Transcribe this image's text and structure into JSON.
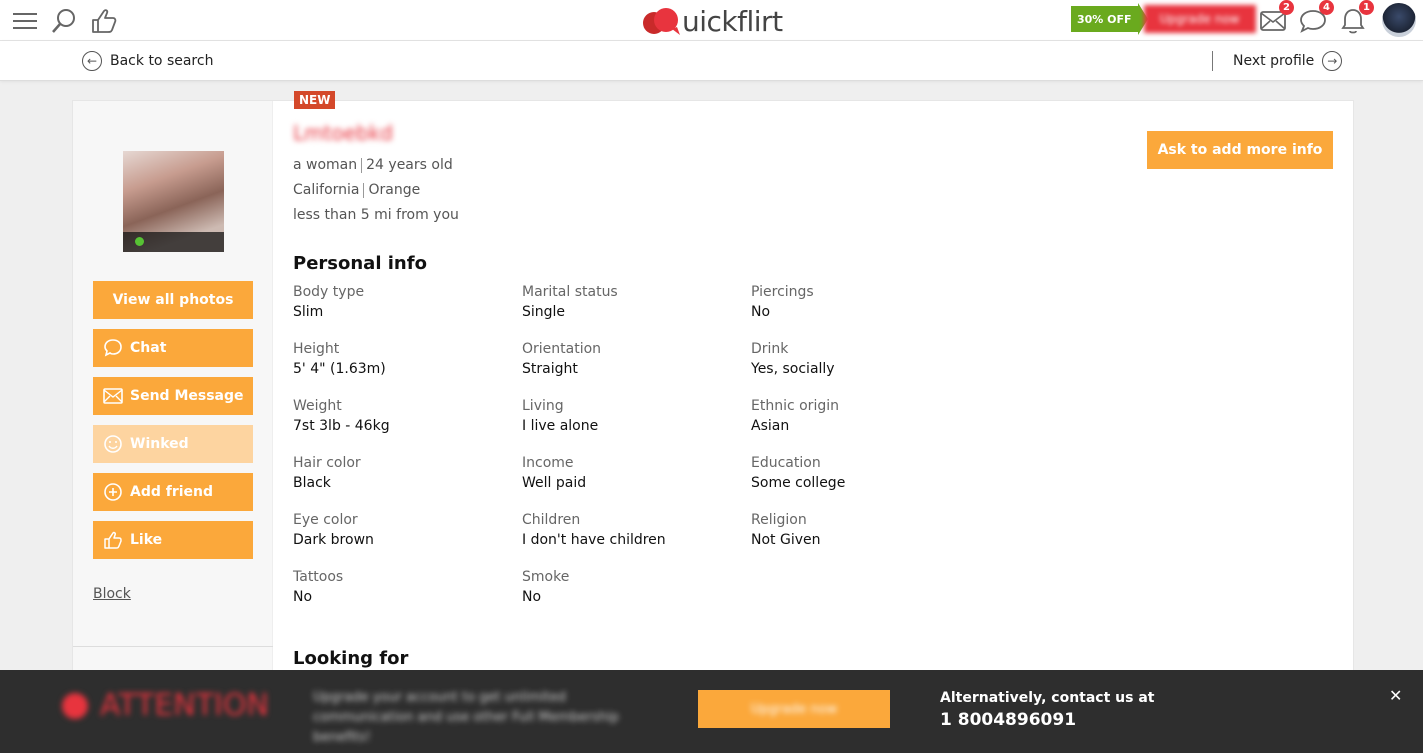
{
  "header": {
    "logo_text": "uickflirt",
    "promo_off": "30% OFF",
    "promo_button": "Upgrade now",
    "badges": {
      "mail": "2",
      "chat": "4",
      "notifications": "1"
    }
  },
  "subnav": {
    "back_label": "Back to search",
    "next_label": "Next profile"
  },
  "profile": {
    "new_tag": "NEW",
    "username": "Lmtoebkd",
    "gender_label": "a woman",
    "age_label": "24 years old",
    "state": "California",
    "city": "Orange",
    "distance": "less than 5 mi from you",
    "ask_button": "Ask to add more info"
  },
  "actions": {
    "view_photos": "View all photos",
    "chat": "Chat",
    "send_message": "Send Message",
    "winked": "Winked",
    "add_friend": "Add friend",
    "like": "Like",
    "block": "Block"
  },
  "personal_info": {
    "title": "Personal info",
    "fields": [
      {
        "label": "Body type",
        "value": "Slim"
      },
      {
        "label": "Height",
        "value": "5' 4\" (1.63m)"
      },
      {
        "label": "Weight",
        "value": "7st 3lb - 46kg"
      },
      {
        "label": "Hair color",
        "value": "Black"
      },
      {
        "label": "Eye color",
        "value": "Dark brown"
      },
      {
        "label": "Tattoos",
        "value": "No"
      },
      {
        "label": "Marital status",
        "value": "Single"
      },
      {
        "label": "Orientation",
        "value": "Straight"
      },
      {
        "label": "Living",
        "value": "I live alone"
      },
      {
        "label": "Income",
        "value": "Well paid"
      },
      {
        "label": "Children",
        "value": "I don't have children"
      },
      {
        "label": "Smoke",
        "value": "No"
      },
      {
        "label": "Piercings",
        "value": "No"
      },
      {
        "label": "Drink",
        "value": "Yes, socially"
      },
      {
        "label": "Ethnic origin",
        "value": "Asian"
      },
      {
        "label": "Education",
        "value": "Some college"
      },
      {
        "label": "Religion",
        "value": "Not Given"
      }
    ]
  },
  "looking_for": {
    "title": "Looking for"
  },
  "banner": {
    "attention": "ATTENTION",
    "text": "Upgrade your account to get unlimited communication and use other Full Membership benefits!",
    "button": "Upgrade now",
    "contact_label": "Alternatively, contact us at",
    "phone": "1 8004896091",
    "close": "✕"
  },
  "colors": {
    "accent": "#fba83b",
    "brand_red": "#e8343e",
    "promo_green": "#6aaa1e",
    "banner_bg": "#2e2e2e"
  }
}
